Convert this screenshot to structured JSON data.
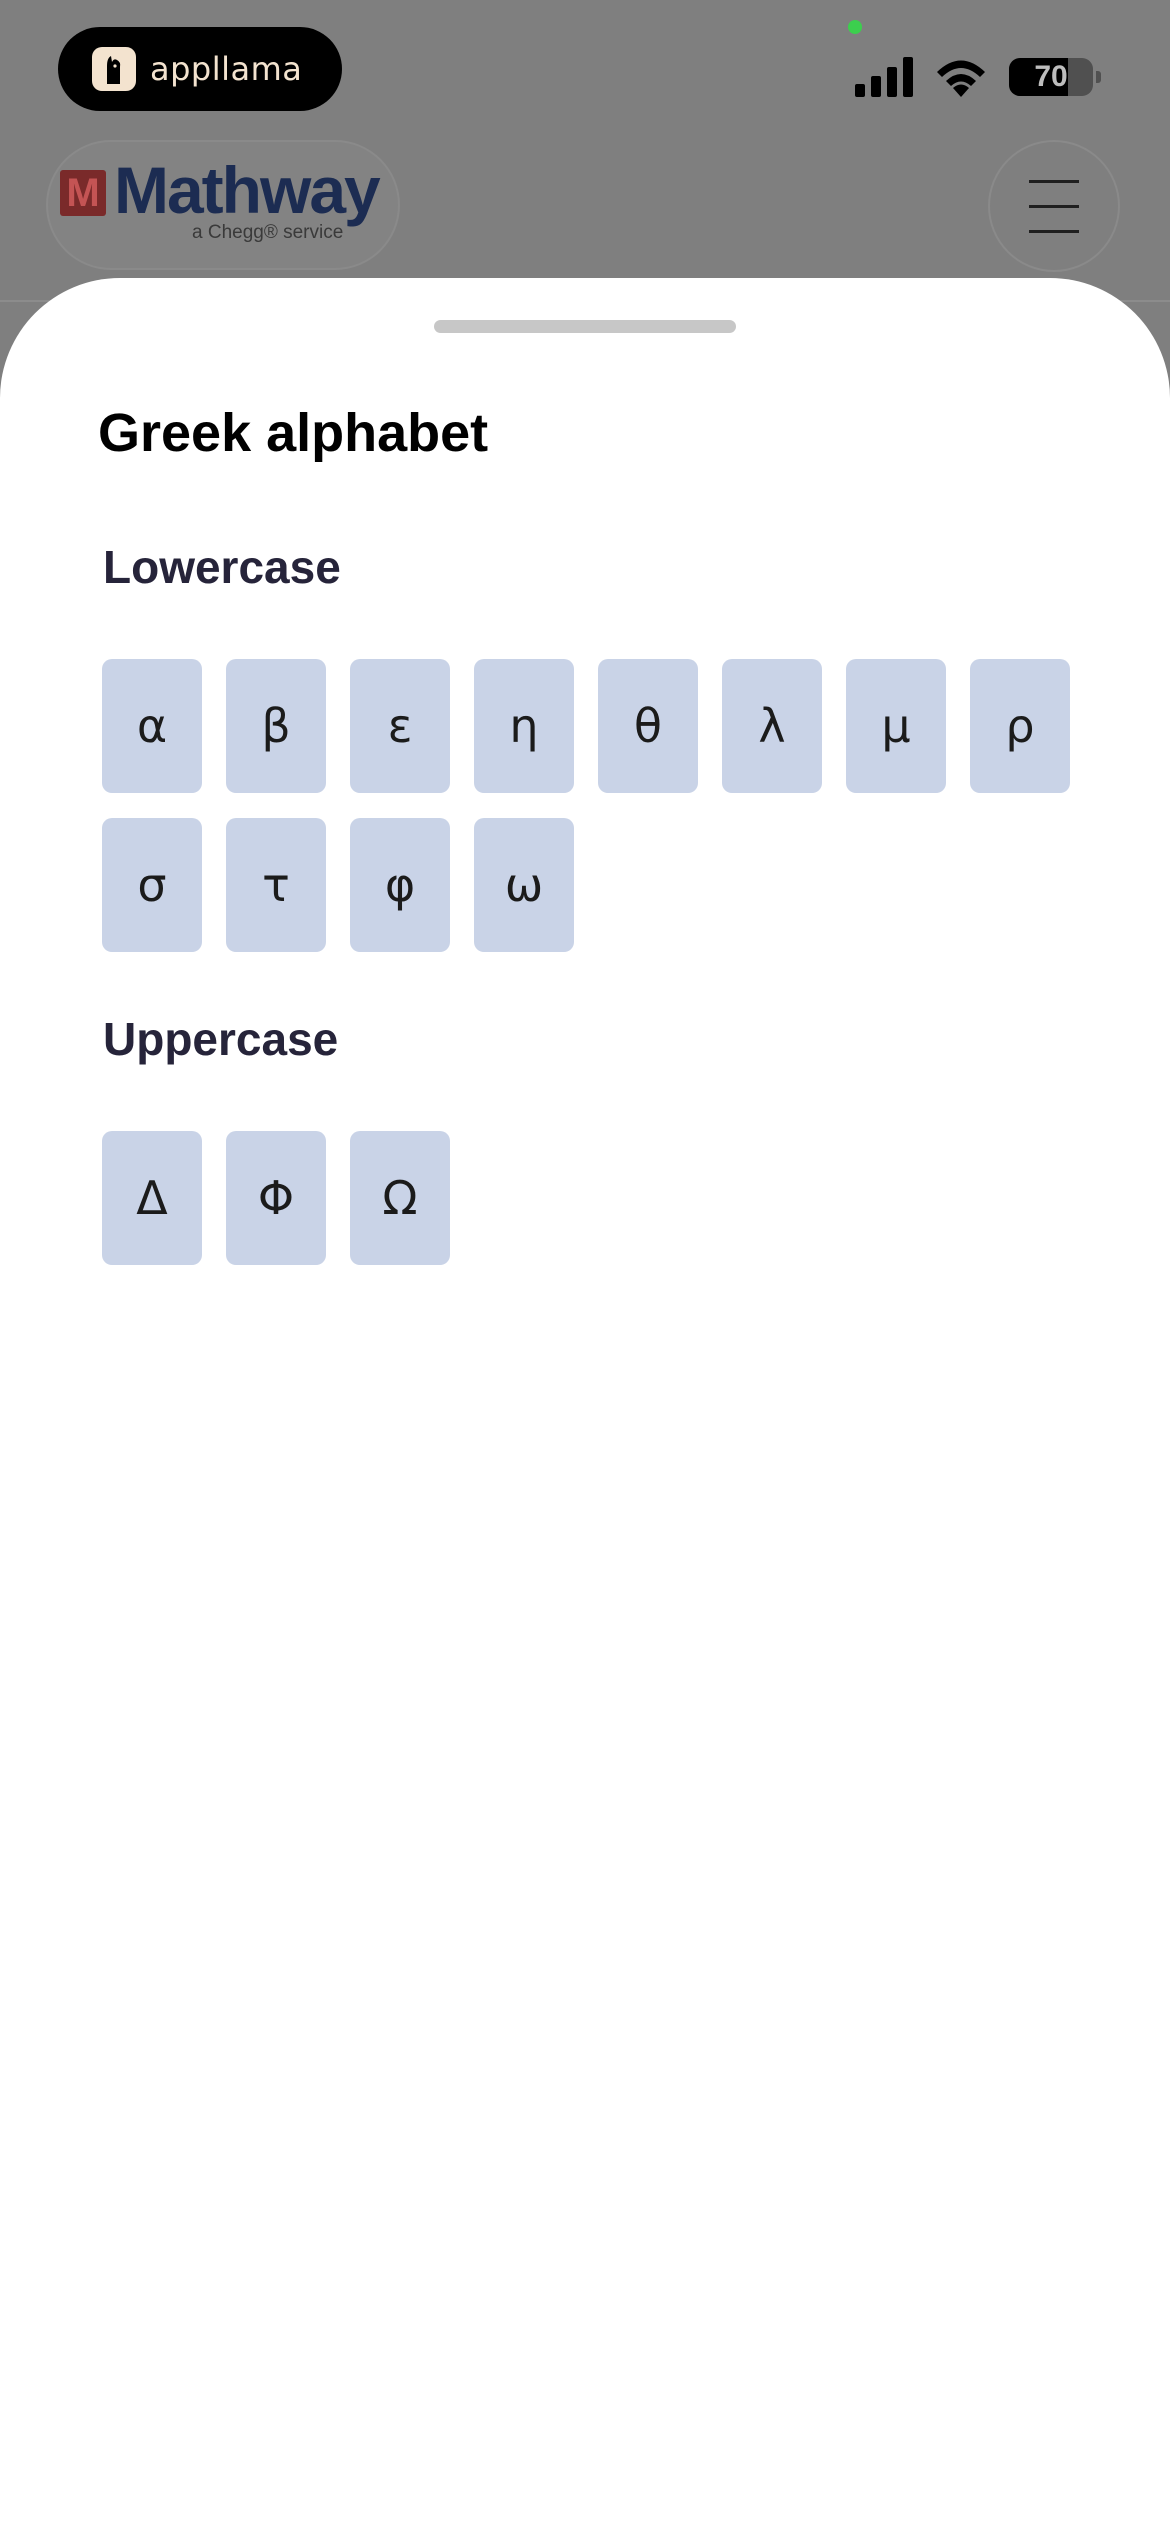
{
  "status_bar": {
    "app_pill_label": "appllama",
    "battery_level": "70",
    "battery_fraction": 0.7
  },
  "header": {
    "brand_mark": "M",
    "brand_name": "Mathway",
    "brand_tagline": "a Chegg® service",
    "menu_icon": "hamburger-menu-icon"
  },
  "sheet": {
    "title": "Greek alphabet",
    "sections": [
      {
        "title": "Lowercase",
        "symbols": [
          "α",
          "β",
          "ε",
          "η",
          "θ",
          "λ",
          "μ",
          "ρ",
          "σ",
          "τ",
          "φ",
          "ω"
        ]
      },
      {
        "title": "Uppercase",
        "symbols": [
          "Δ",
          "Φ",
          "Ω"
        ]
      }
    ]
  },
  "colors": {
    "key_background": "#c9d3e7",
    "section_title": "#26243a",
    "brand_navy": "#1c2c52",
    "status_dot": "#3ccf4e"
  }
}
